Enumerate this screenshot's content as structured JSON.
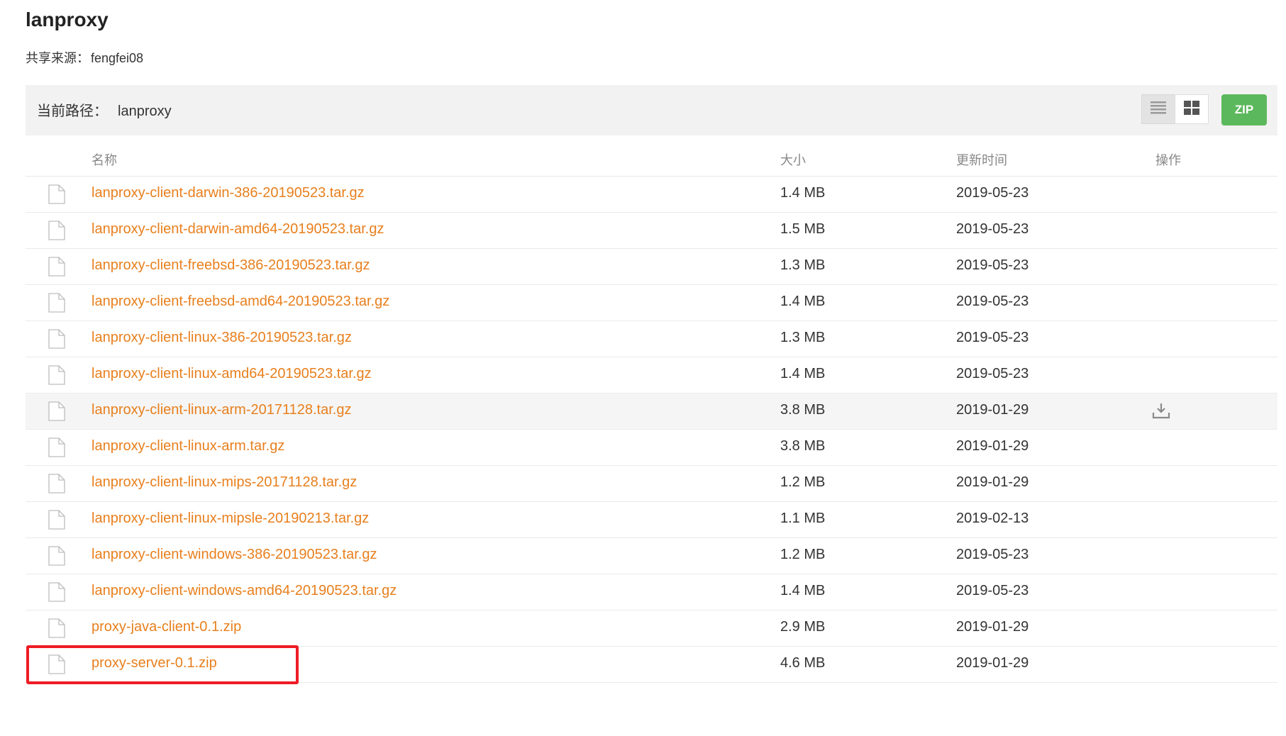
{
  "header": {
    "title": "lanproxy",
    "source_label": "共享来源：",
    "source_value": "fengfei08"
  },
  "pathbar": {
    "label": "当前路径：",
    "value": "lanproxy",
    "zip_label": "ZIP",
    "view_list_icon": "list-view-icon",
    "view_grid_icon": "grid-view-icon"
  },
  "table": {
    "columns": {
      "name": "名称",
      "size": "大小",
      "date": "更新时间",
      "op": "操作"
    },
    "rows": [
      {
        "name": "lanproxy-client-darwin-386-20190523.tar.gz",
        "size": "1.4 MB",
        "date": "2019-05-23"
      },
      {
        "name": "lanproxy-client-darwin-amd64-20190523.tar.gz",
        "size": "1.5 MB",
        "date": "2019-05-23"
      },
      {
        "name": "lanproxy-client-freebsd-386-20190523.tar.gz",
        "size": "1.3 MB",
        "date": "2019-05-23"
      },
      {
        "name": "lanproxy-client-freebsd-amd64-20190523.tar.gz",
        "size": "1.4 MB",
        "date": "2019-05-23"
      },
      {
        "name": "lanproxy-client-linux-386-20190523.tar.gz",
        "size": "1.3 MB",
        "date": "2019-05-23"
      },
      {
        "name": "lanproxy-client-linux-amd64-20190523.tar.gz",
        "size": "1.4 MB",
        "date": "2019-05-23"
      },
      {
        "name": "lanproxy-client-linux-arm-20171128.tar.gz",
        "size": "3.8 MB",
        "date": "2019-01-29"
      },
      {
        "name": "lanproxy-client-linux-arm.tar.gz",
        "size": "3.8 MB",
        "date": "2019-01-29"
      },
      {
        "name": "lanproxy-client-linux-mips-20171128.tar.gz",
        "size": "1.2 MB",
        "date": "2019-01-29"
      },
      {
        "name": "lanproxy-client-linux-mipsle-20190213.tar.gz",
        "size": "1.1 MB",
        "date": "2019-02-13"
      },
      {
        "name": "lanproxy-client-windows-386-20190523.tar.gz",
        "size": "1.2 MB",
        "date": "2019-05-23"
      },
      {
        "name": "lanproxy-client-windows-amd64-20190523.tar.gz",
        "size": "1.4 MB",
        "date": "2019-05-23"
      },
      {
        "name": "proxy-java-client-0.1.zip",
        "size": "2.9 MB",
        "date": "2019-01-29"
      },
      {
        "name": "proxy-server-0.1.zip",
        "size": "4.6 MB",
        "date": "2019-01-29"
      }
    ],
    "hover_row_index": 6,
    "highlighted_row_index": 13,
    "file_icon": "file-icon",
    "download_icon": "download-icon"
  },
  "colors": {
    "link": "#e87f1d",
    "zip_button": "#5cb85c",
    "highlight_border": "#ee1c25"
  }
}
